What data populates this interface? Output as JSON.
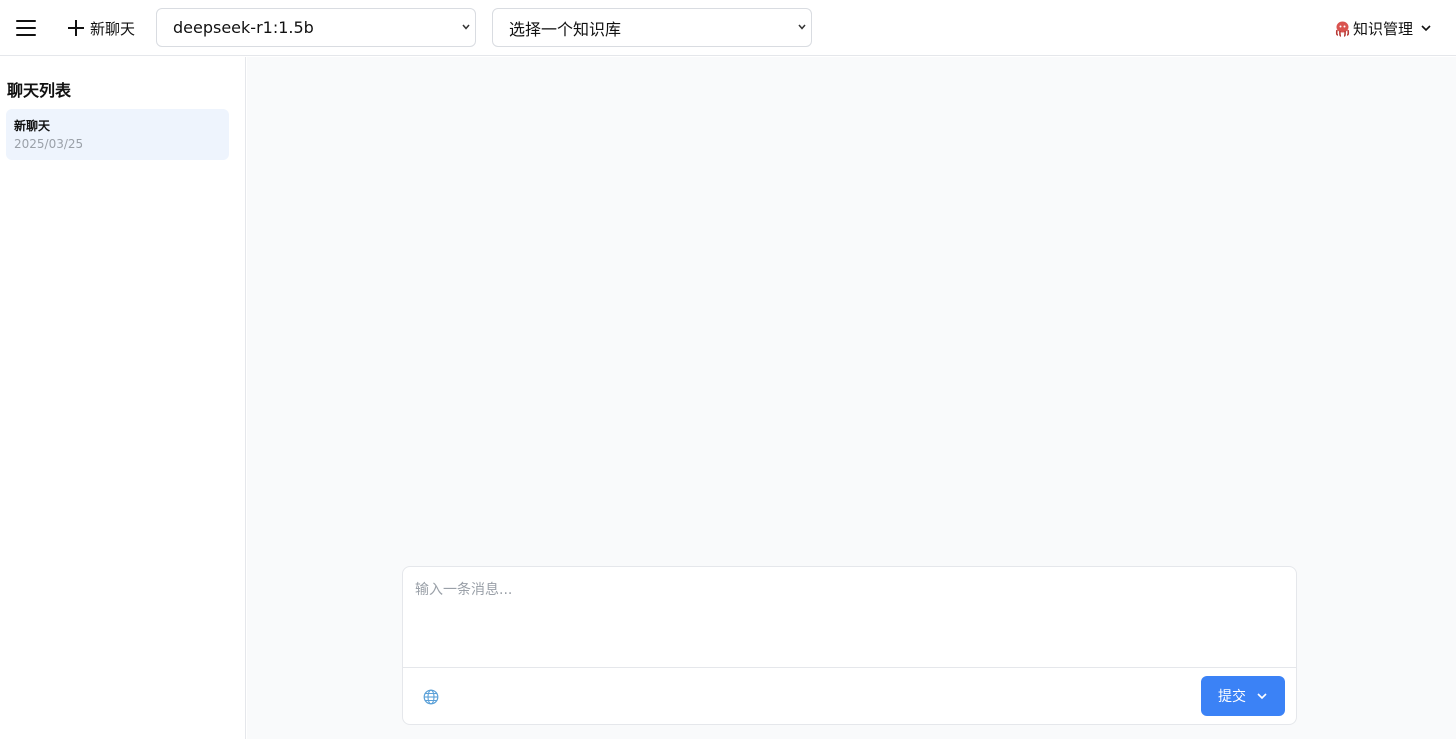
{
  "header": {
    "menu_icon": "hamburger-icon",
    "new_chat_label": "新聊天",
    "model_select_value": "deepseek-r1:1.5b",
    "kb_select_value": "选择一个知识库",
    "kb_menu_label": "知识管理",
    "kb_menu_icon": "octopus-icon"
  },
  "sidebar": {
    "title": "聊天列表",
    "items": [
      {
        "title": "新聊天",
        "date": "2025/03/25"
      }
    ]
  },
  "composer": {
    "placeholder": "输入一条消息...",
    "submit_label": "提交",
    "web_search_icon": "globe-icon"
  },
  "colors": {
    "accent": "#3b82f6",
    "selected_item_bg": "#eef4fd",
    "main_bg": "#f9fafb",
    "border": "#e5e7eb"
  }
}
